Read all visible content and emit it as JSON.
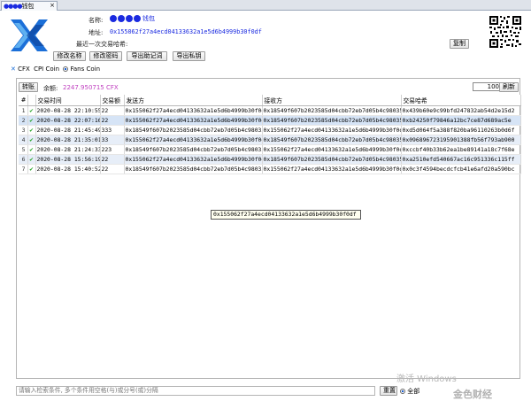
{
  "tab": {
    "blot": "●●●●",
    "suffix": "钱包",
    "close": "×"
  },
  "header": {
    "name_label": "名称:",
    "name_blot": "●●●●",
    "name_suffix": "钱包",
    "address_label": "地址:",
    "address_value": "0x155062f27a4ecd04133632a1e5d6b4999b30f0df",
    "last_hash_label": "最近一次交易哈希:",
    "copy_label": "复制",
    "actions": [
      "修改名称",
      "修改密码",
      "导出助记词",
      "导出私钥"
    ]
  },
  "coin_radios": [
    {
      "label": "CFX",
      "selected": false
    },
    {
      "label": "CPI Coin",
      "selected": false
    },
    {
      "label": "Fans Coin",
      "selected": true
    }
  ],
  "toolbar": {
    "transfer_label": "转账",
    "balance_label": "余额:",
    "balance_value": "2247.950715 CFX",
    "count_value": "100",
    "refresh_label": "刷新"
  },
  "table": {
    "columns": [
      "#",
      "",
      "交易时间",
      "交易额",
      "发送方",
      "接收方",
      "交易哈希"
    ],
    "rows": [
      [
        "1",
        "✔",
        "2020-08-28 22:10:55",
        "22",
        "0x155062f27a4ecd04133632a1e5d6b4999b30f0df",
        "0x18549f607b2023585d04cbb72eb7d05b4c980355",
        "0x439b60e9c99bfd247832ab54d2e15d2"
      ],
      [
        "2",
        "✔",
        "2020-08-28 22:07:16",
        "22",
        "0x155062f27a4ecd04133632a1e5d6b4999b30f0df",
        "0x18549f607b2023585d04cbb72eb7d05b4c980355",
        "0xb24250f79846a12bc7ce87d689ac5e"
      ],
      [
        "3",
        "✔",
        "2020-08-28 21:45:49",
        "333",
        "0x18549f607b2023585d04cbb72eb7d05b4c980355",
        "0x155062f27a4ecd04133632a1e5d6b4999b30f0df",
        "0xd5d064f5a388f820ba96110263b0d6f"
      ],
      [
        "4",
        "✔",
        "2020-08-28 21:35:01",
        "33",
        "0x155062f27a4ecd04133632a1e5d6b4999b30f0df",
        "0x18549f607b2023585d04cbb72eb7d05b4c980355",
        "0x096896723195901388fb56f793ab900"
      ],
      [
        "5",
        "✔",
        "2020-08-28 21:24:33",
        "223",
        "0x18549f607b2023585d04cbb72eb7d05b4c980355",
        "0x155062f27a4ecd04133632a1e5d6b4999b30f0df",
        "0xccbf40b33b62ea1be89141a18c7f68e"
      ],
      [
        "6",
        "✔",
        "2020-08-28 15:56:19",
        "22",
        "0x155062f27a4ecd04133632a1e5d6b4999b30f0df",
        "0x18549f607b2023585d04cbb72eb7d05b4c980355",
        "0xa2510efd540667ac16c951336c115ff"
      ],
      [
        "7",
        "✔",
        "2020-08-28 15:40:52",
        "22",
        "0x18549f607b2023585d04cbb72eb7d05b4c980355",
        "0x155062f27a4ecd04133632a1e5d6b4999b30f0df",
        "0x0c3f4594becdcfcb41e6afd20a590bc"
      ]
    ]
  },
  "tooltip": "0x155062f27a4ecd04133632a1e5d6b4999b30f0df",
  "search": {
    "placeholder": "请输入检索条件, 多个条件用空格(与)或分号(或)分隔"
  },
  "footer": {
    "reset_label": "重置",
    "all_label": "全部",
    "watermark": "激活 Windows",
    "brand": "金色财经"
  },
  "colors": {
    "accent_blue": "#1a2ae0",
    "balance": "#c040c0",
    "check": "#2aa52a"
  }
}
